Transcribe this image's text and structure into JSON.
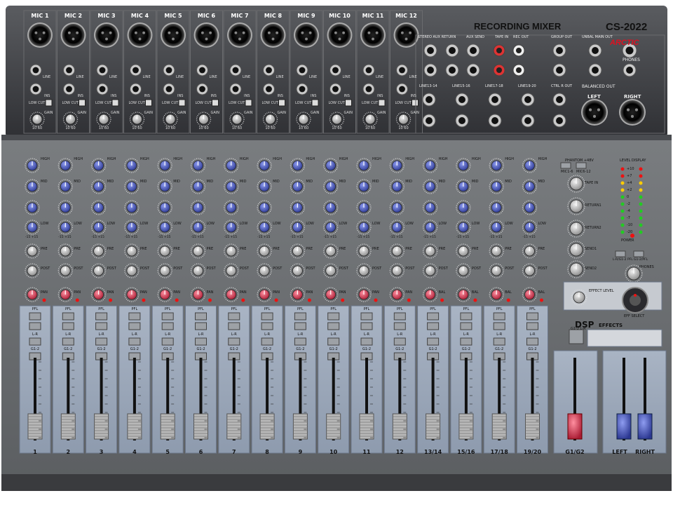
{
  "header": {
    "title": "RECORDING MIXER",
    "model": "CS-2022",
    "brand": "ARCTIC"
  },
  "mic_channels": [
    "MIC 1",
    "MIC 2",
    "MIC 3",
    "MIC 4",
    "MIC 5",
    "MIC 6",
    "MIC 7",
    "MIC 8",
    "MIC 9",
    "MIC 10",
    "MIC 11",
    "MIC 12"
  ],
  "input_labels": {
    "line": "LINE",
    "ins": "INS",
    "low_cut": "LOW CUT",
    "gain": "GAIN",
    "gain_scale": "10   60"
  },
  "rear_sections": {
    "stereo_aux_return": "STEREO AUX RETURN",
    "aux_send": "AUX SEND",
    "tape_in": "TAPE IN",
    "rec_out": "REC OUT",
    "group_out": "GROUP OUT",
    "unbal_main_out": "UNBAL MAIN OUT",
    "phones": "PHONES",
    "balanced_out": "BALANCED OUT",
    "ctrl_r_out": "CTRL R OUT",
    "left": "LEFT",
    "right": "RIGHT",
    "line_pairs": [
      "LINE13-14",
      "LINE15-16",
      "LINE17-18",
      "LINE19-20"
    ],
    "mono": "L/ MONO",
    "r": "R"
  },
  "eq_labels": {
    "high": "HIGH",
    "high_freq": "12kHz",
    "mid": "MID",
    "mid_freq": "FRQ",
    "low": "LOW",
    "low_freq": "80Hz",
    "pre": "PRE",
    "post": "POST",
    "pan": "PAN",
    "bal": "BAL",
    "peak": "PEAK",
    "scale": "-15  +15"
  },
  "buttons": {
    "pfl": "PFL",
    "lr": "L-R",
    "g12": "G1-2"
  },
  "master": {
    "phantom": "PHANTOM +48V",
    "mic_1_6": "MIC1-6",
    "mic_6_12": "MIC6-12",
    "level_display": "LEVEL DISPLAY",
    "level_marks": [
      "+10",
      "+7",
      "+4",
      "+2",
      "0",
      "-2",
      "-4",
      "-7",
      "-10",
      "-20"
    ],
    "power": "POWER",
    "tape_in": "TAPE IN",
    "return1": "RETURN1",
    "return2": "RETURN2",
    "send1": "SEND1",
    "send2": "SEND2",
    "lr_pfl": "L-R/G1-2 PFL",
    "g1_pfl": "G1-2/PFL",
    "phones": "PHONES",
    "effect_level": "EFFECT LEVEL",
    "eff_select": "EFF SELECT",
    "dsp": "DSP",
    "effects": "EFFECTS",
    "g12_lr": "G1-2 L-R"
  },
  "strip_labels": [
    "1",
    "2",
    "3",
    "4",
    "5",
    "6",
    "7",
    "8",
    "9",
    "10",
    "11",
    "12",
    "13/14",
    "15/16",
    "17/18",
    "19/20",
    "G1/G2",
    "LEFT",
    "RIGHT"
  ],
  "fader_scale": [
    "10",
    "5",
    "0",
    "5",
    "10",
    "20",
    "30",
    "40",
    "50",
    "60"
  ],
  "colors": {
    "panel": "#3a3b3f",
    "lower_panel": "#6d7073",
    "strip": "#9aa6b6",
    "knob_blue": "#3f4fa6",
    "knob_red": "#d2314a",
    "fader_red": "#e8325a",
    "fader_blue": "#3a6fd0"
  }
}
